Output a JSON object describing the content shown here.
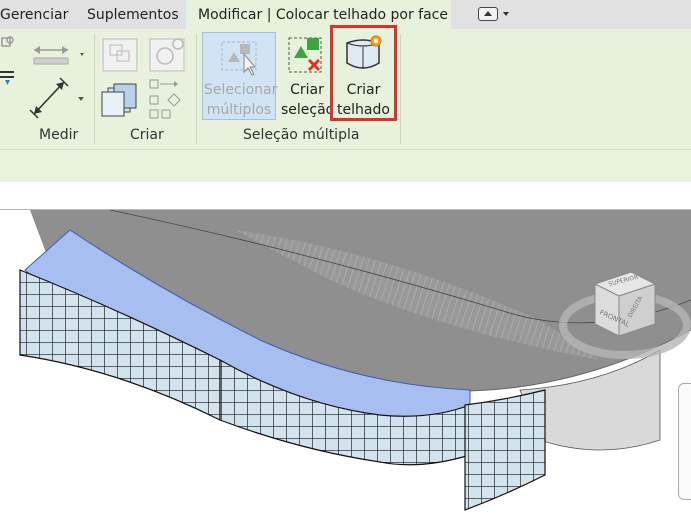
{
  "tabs": [
    {
      "label": "Gerenciar",
      "active": false
    },
    {
      "label": "Suplementos",
      "active": false
    },
    {
      "label": "Modificar | Colocar telhado por face",
      "active": true
    }
  ],
  "panels": {
    "measure": {
      "title": "Medir"
    },
    "create": {
      "title": "Criar"
    },
    "multi_select": {
      "title": "Seleção múltipla",
      "select_multiple": {
        "line1": "Selecionar",
        "line2": "múltiplos",
        "enabled": false
      },
      "create_selection": {
        "line1": "Criar",
        "line2": "seleção",
        "enabled": true
      },
      "create_roof": {
        "line1": "Criar",
        "line2": "telhado",
        "enabled": true,
        "highlighted": true
      }
    }
  },
  "viewport": {
    "navcube": {
      "face_front": "FRONTAL",
      "face_right": "DIREITA",
      "face_top": "SUPERIOR"
    }
  },
  "colors": {
    "ribbon": "#e8f1db",
    "tabbar": "#e1e1e1",
    "highlight": "#e0302a",
    "glass": "#cfe0ec"
  }
}
